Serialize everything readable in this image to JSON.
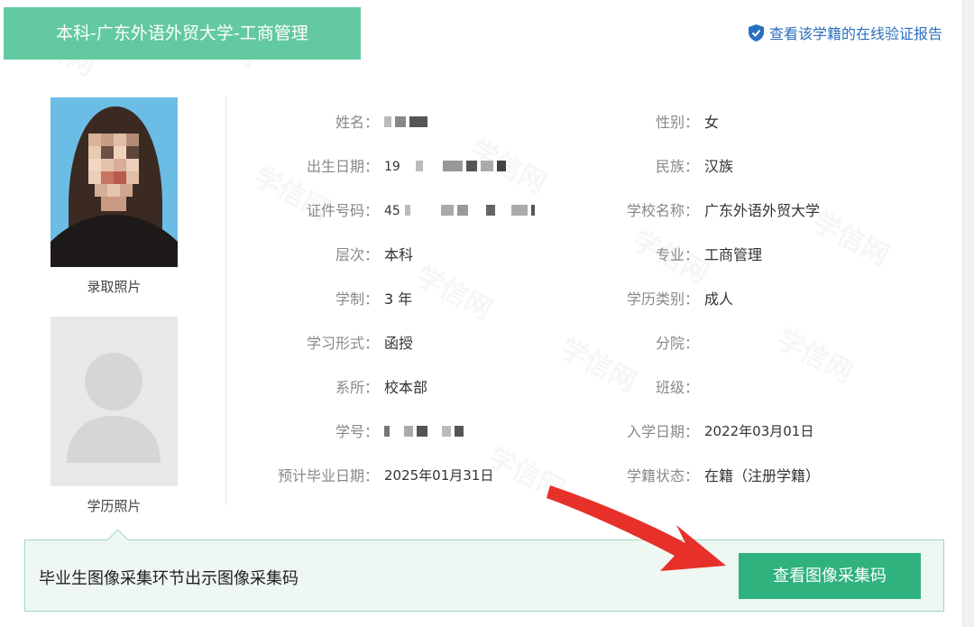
{
  "header": {
    "title": "本科-广东外语外贸大学-工商管理",
    "verify_link": "查看该学籍的在线验证报告"
  },
  "photos": {
    "admission_caption": "录取照片",
    "diploma_caption": "学历照片"
  },
  "watermark": "学信网",
  "left_fields": [
    {
      "label": "姓名：",
      "value": ""
    },
    {
      "label": "出生日期：",
      "value": "19"
    },
    {
      "label": "证件号码：",
      "value": "45"
    },
    {
      "label": "层次：",
      "value": "本科"
    },
    {
      "label": "学制：",
      "value": "3 年"
    },
    {
      "label": "学习形式：",
      "value": "函授"
    },
    {
      "label": "系所：",
      "value": "校本部"
    },
    {
      "label": "学号：",
      "value": ""
    },
    {
      "label": "预计毕业日期：",
      "value": "2025年01月31日"
    }
  ],
  "right_fields": [
    {
      "label": "性别：",
      "value": "女"
    },
    {
      "label": "民族：",
      "value": "汉族"
    },
    {
      "label": "学校名称：",
      "value": "广东外语外贸大学"
    },
    {
      "label": "专业：",
      "value": "工商管理"
    },
    {
      "label": "学历类别：",
      "value": "成人"
    },
    {
      "label": "分院：",
      "value": ""
    },
    {
      "label": "班级：",
      "value": ""
    },
    {
      "label": "入学日期：",
      "value": "2022年03月01日"
    },
    {
      "label": "学籍状态：",
      "value": "在籍（注册学籍）"
    }
  ],
  "bottom": {
    "text": "毕业生图像采集环节出示图像采集码",
    "button": "查看图像采集码"
  },
  "colors": {
    "header_green": "#63c9a0",
    "button_green": "#2fb27d",
    "link_blue": "#2b6fbf",
    "arrow_red": "#e8302a"
  }
}
